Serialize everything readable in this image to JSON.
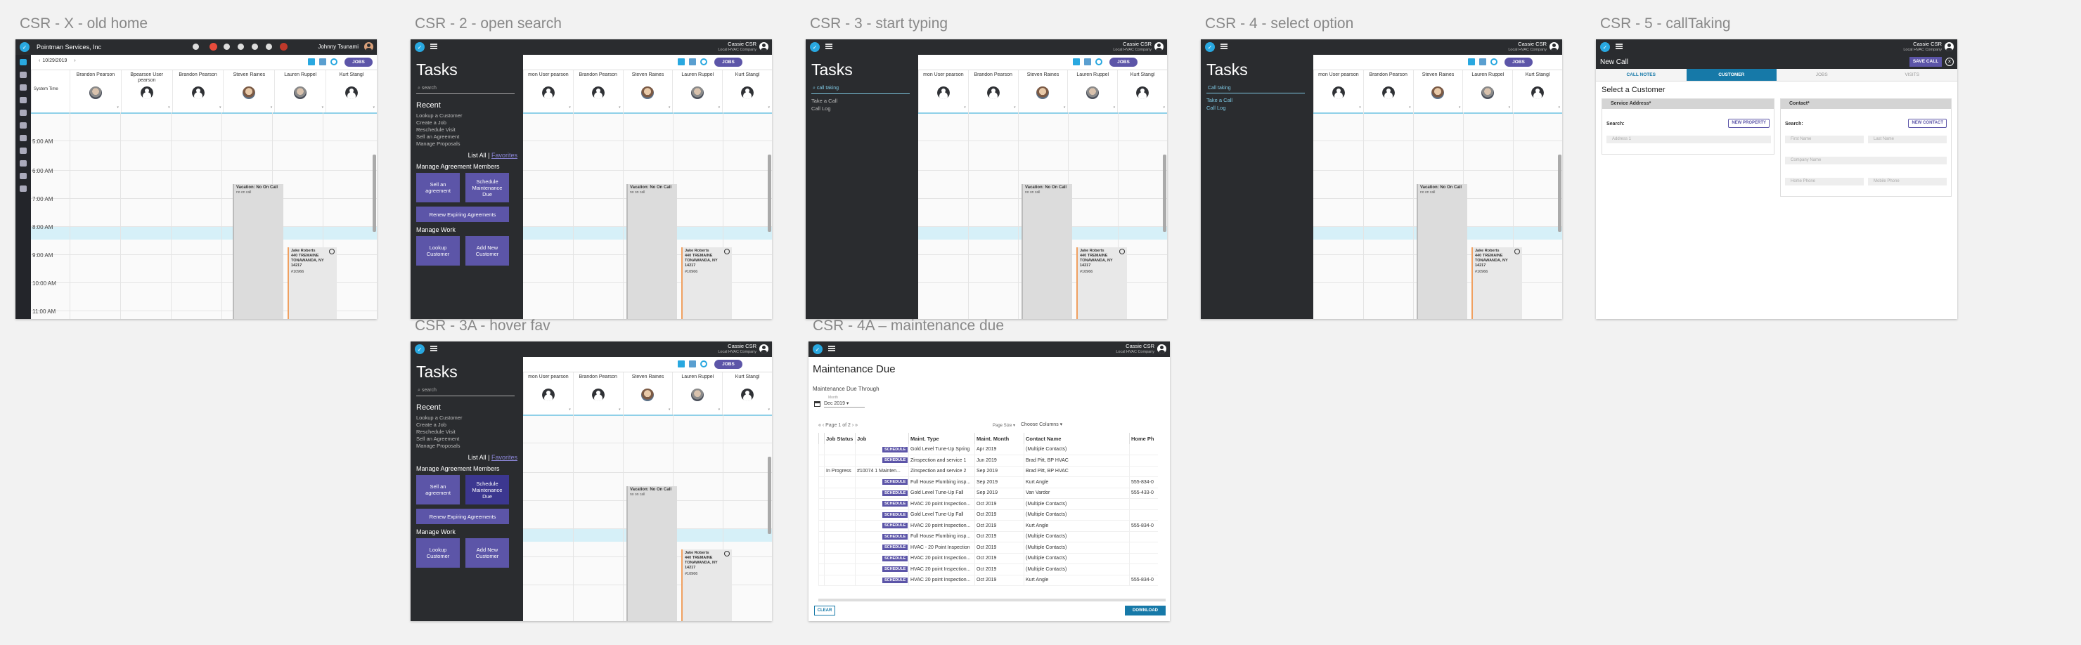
{
  "titles": {
    "f1": "CSR - X - old home",
    "f2": "CSR - 2 - open search",
    "f3": "CSR - 3 - start typing",
    "f4": "CSR - 4 - select option",
    "f5": "CSR - 5 - callTaking",
    "f6": "CSR - 3A - hover fav",
    "f7": "CSR - 4A – maintenance due"
  },
  "common": {
    "user_name": "Cassie CSR",
    "user_company": "Local HVAC Company",
    "jobs_label": "JOBS"
  },
  "old_home": {
    "company": "Pointman Services, Inc",
    "user": "Johnny Tsunami",
    "date": "10/29/2019",
    "col_header": "System Time",
    "times": [
      "5:00 AM",
      "6:00 AM",
      "7:00 AM",
      "8:00 AM",
      "9:00 AM",
      "10:00 AM",
      "11:00 AM"
    ]
  },
  "techs": [
    {
      "name": "Brandon Pearson"
    },
    {
      "name": "Bpearson User pearson"
    },
    {
      "name": "Brandon Pearson"
    },
    {
      "name": "Steven Raines"
    },
    {
      "name": "Lauren Ruppel"
    },
    {
      "name": "Kurt Stangl"
    }
  ],
  "techs_partial": [
    {
      "name": "mon User pearson"
    },
    {
      "name": "Brandon Pearson"
    },
    {
      "name": "Steven Raines"
    },
    {
      "name": "Lauren Ruppel"
    },
    {
      "name": "Kurt Stangl"
    }
  ],
  "vacation": {
    "title": "Vacation: No On Call",
    "sub": "no on call"
  },
  "job": {
    "l1": "Jake Roberts",
    "l2": "440 TREMAINE",
    "l3": "TONAWANDA, NY",
    "l4": "14217",
    "num": "#10966"
  },
  "tasks": {
    "title": "Tasks",
    "search_placeholder": "search",
    "typed_value": "call taking",
    "recent_head": "Recent",
    "recent": [
      "Lookup a Customer",
      "Create a Job",
      "Reschedule Visit",
      "Sell an Agreement",
      "Manage Proposals"
    ],
    "list_all": "List All",
    "sep": "|",
    "favorites": "Favorites",
    "agreements_head": "Manage Agreement Members",
    "sell_agreement": "Sell an agreement",
    "schedule_due": "Schedule Maintenance Due",
    "renew": "Renew Expiring Agreements",
    "work_head": "Manage Work",
    "lookup": "Lookup Customer",
    "add_new": "Add New Customer",
    "options": [
      "Call taking",
      "Take a Call",
      "Call Log"
    ]
  },
  "call": {
    "title": "New Call",
    "save": "SAVE CALL",
    "close": "×",
    "tabs": [
      "CALL NOTES",
      "CUSTOMER",
      "JOBS",
      "VISITS"
    ],
    "select_customer": "Select a Customer",
    "svc_head": "Service Address*",
    "contact_head": "Contact*",
    "search_label": "Search:",
    "new_property": "NEW PROPERTY",
    "new_contact": "NEW CONTACT",
    "address_ph": "Address 1",
    "first_ph": "First Name",
    "last_ph": "Last Name",
    "company_ph": "Company Name",
    "home_ph": "Home Phone",
    "mobile_ph": "Mobile Phone"
  },
  "maint": {
    "title": "Maintenance Due",
    "through": "Maintenance Due Through",
    "month_label": "Month",
    "month": "Dec 2019",
    "pager": "Page 1 of 2",
    "page_size": "Page Size",
    "choose_cols": "Choose Columns",
    "columns": [
      "Job Status",
      "Job",
      "Maint. Type",
      "Maint. Month",
      "Contact Name",
      "Home Ph"
    ],
    "rows": [
      {
        "status": "",
        "job": "SCHEDULE",
        "type": "Gold Level Tune-Up Spring",
        "month": "Apr 2019",
        "contact": "(Multiple Contacts)",
        "phone": ""
      },
      {
        "status": "",
        "job": "SCHEDULE",
        "type": "Zinspection and service 1",
        "month": "Jun 2019",
        "contact": "Brad Pitt, BP HVAC",
        "phone": ""
      },
      {
        "status": "In Progress",
        "job": "#10074 1 Mainten...",
        "type": "Zinspection and service 2",
        "month": "Sep 2019",
        "contact": "Brad Pitt, BP HVAC",
        "phone": ""
      },
      {
        "status": "",
        "job": "SCHEDULE",
        "type": "Full House Plumbing insp...",
        "month": "Sep 2019",
        "contact": "Kurt Angle",
        "phone": "555-834-0"
      },
      {
        "status": "",
        "job": "SCHEDULE",
        "type": "Gold Level Tune-Up Fall",
        "month": "Sep 2019",
        "contact": "Van Vardor",
        "phone": "555-433-0"
      },
      {
        "status": "",
        "job": "SCHEDULE",
        "type": "HVAC 20 point Inspection...",
        "month": "Oct 2019",
        "contact": "(Multiple Contacts)",
        "phone": ""
      },
      {
        "status": "",
        "job": "SCHEDULE",
        "type": "Gold Level Tune-Up Fall",
        "month": "Oct 2019",
        "contact": "(Multiple Contacts)",
        "phone": ""
      },
      {
        "status": "",
        "job": "SCHEDULE",
        "type": "HVAC 20 point Inspection...",
        "month": "Oct 2019",
        "contact": "Kurt Angle",
        "phone": "555-834-0"
      },
      {
        "status": "",
        "job": "SCHEDULE",
        "type": "Full House Plumbing insp...",
        "month": "Oct 2019",
        "contact": "(Multiple Contacts)",
        "phone": ""
      },
      {
        "status": "",
        "job": "SCHEDULE",
        "type": "HVAC - 20 Point Inspection",
        "month": "Oct 2019",
        "contact": "(Multiple Contacts)",
        "phone": ""
      },
      {
        "status": "",
        "job": "SCHEDULE",
        "type": "HVAC 20 point Inspection...",
        "month": "Oct 2019",
        "contact": "(Multiple Contacts)",
        "phone": ""
      },
      {
        "status": "",
        "job": "SCHEDULE",
        "type": "HVAC 20 point Inspection...",
        "month": "Oct 2019",
        "contact": "(Multiple Contacts)",
        "phone": ""
      },
      {
        "status": "",
        "job": "SCHEDULE",
        "type": "HVAC 20 point Inspection...",
        "month": "Oct 2019",
        "contact": "Kurt Angle",
        "phone": "555-834-0"
      }
    ],
    "clear": "CLEAR",
    "download": "DOWNLOAD"
  },
  "colors": {
    "accent": "#5c55a8",
    "brand_blue": "#29a8e0",
    "dark": "#2a2c2f",
    "teal": "#1679a8"
  }
}
